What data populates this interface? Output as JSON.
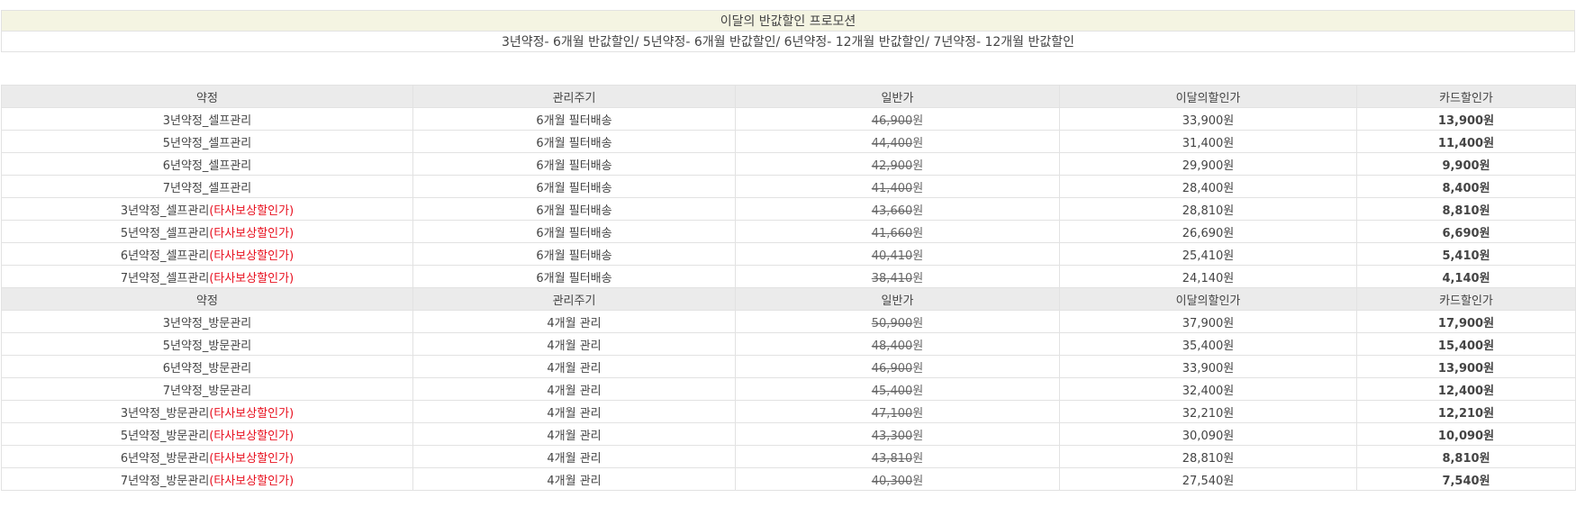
{
  "promo": {
    "title": "이달의 반값할인 프로모션",
    "description": "3년약정- 6개월 반값할인/ 5년약정- 6개월 반값할인/ 6년약정- 12개월 반값할인/ 7년약정- 12개월 반값할인"
  },
  "currency": "원",
  "colors": {
    "accent_red": "#e8101f",
    "header_bg": "#ebebeb",
    "promo_bg": "#f4f4e2"
  },
  "sections": [
    {
      "headers": [
        "약정",
        "관리주기",
        "일반가",
        "이달의할인가",
        "카드할인가"
      ],
      "rows": [
        {
          "plan": "3년약정_셀프관리",
          "note": "",
          "cycle": "6개월 필터배송",
          "regular": "46,900",
          "sale": "33,900원",
          "card": "13,900원"
        },
        {
          "plan": "5년약정_셀프관리",
          "note": "",
          "cycle": "6개월 필터배송",
          "regular": "44,400",
          "sale": "31,400원",
          "card": "11,400원"
        },
        {
          "plan": "6년약정_셀프관리",
          "note": "",
          "cycle": "6개월 필터배송",
          "regular": "42,900",
          "sale": "29,900원",
          "card": "9,900원"
        },
        {
          "plan": "7년약정_셀프관리",
          "note": "",
          "cycle": "6개월 필터배송",
          "regular": "41,400",
          "sale": "28,400원",
          "card": "8,400원"
        },
        {
          "plan": "3년약정_셀프관리",
          "note": "(타사보상할인가)",
          "cycle": "6개월 필터배송",
          "regular": "43,660",
          "sale": "28,810원",
          "card": "8,810원"
        },
        {
          "plan": "5년약정_셀프관리",
          "note": "(타사보상할인가)",
          "cycle": "6개월 필터배송",
          "regular": "41,660",
          "sale": "26,690원",
          "card": "6,690원"
        },
        {
          "plan": "6년약정_셀프관리",
          "note": "(타사보상할인가)",
          "cycle": "6개월 필터배송",
          "regular": "40,410",
          "sale": "25,410원",
          "card": "5,410원"
        },
        {
          "plan": "7년약정_셀프관리",
          "note": "(타사보상할인가)",
          "cycle": "6개월 필터배송",
          "regular": "38,410",
          "sale": "24,140원",
          "card": "4,140원"
        }
      ]
    },
    {
      "headers": [
        "약정",
        "관리주기",
        "일반가",
        "이달의할인가",
        "카드할인가"
      ],
      "rows": [
        {
          "plan": "3년약정_방문관리",
          "note": "",
          "cycle": "4개월 관리",
          "regular": "50,900",
          "sale": "37,900원",
          "card": "17,900원"
        },
        {
          "plan": "5년약정_방문관리",
          "note": "",
          "cycle": "4개월 관리",
          "regular": "48,400",
          "sale": "35,400원",
          "card": "15,400원"
        },
        {
          "plan": "6년약정_방문관리",
          "note": "",
          "cycle": "4개월 관리",
          "regular": "46,900",
          "sale": "33,900원",
          "card": "13,900원"
        },
        {
          "plan": "7년약정_방문관리",
          "note": "",
          "cycle": "4개월 관리",
          "regular": "45,400",
          "sale": "32,400원",
          "card": "12,400원"
        },
        {
          "plan": "3년약정_방문관리",
          "note": "(타사보상할인가)",
          "cycle": "4개월 관리",
          "regular": "47,100",
          "sale": "32,210원",
          "card": "12,210원"
        },
        {
          "plan": "5년약정_방문관리",
          "note": "(타사보상할인가)",
          "cycle": "4개월 관리",
          "regular": "43,300",
          "sale": "30,090원",
          "card": "10,090원"
        },
        {
          "plan": "6년약정_방문관리",
          "note": "(타사보상할인가)",
          "cycle": "4개월 관리",
          "regular": "43,810",
          "sale": "28,810원",
          "card": "8,810원"
        },
        {
          "plan": "7년약정_방문관리",
          "note": "(타사보상할인가)",
          "cycle": "4개월 관리",
          "regular": "40,300",
          "sale": "27,540원",
          "card": "7,540원"
        }
      ]
    }
  ]
}
